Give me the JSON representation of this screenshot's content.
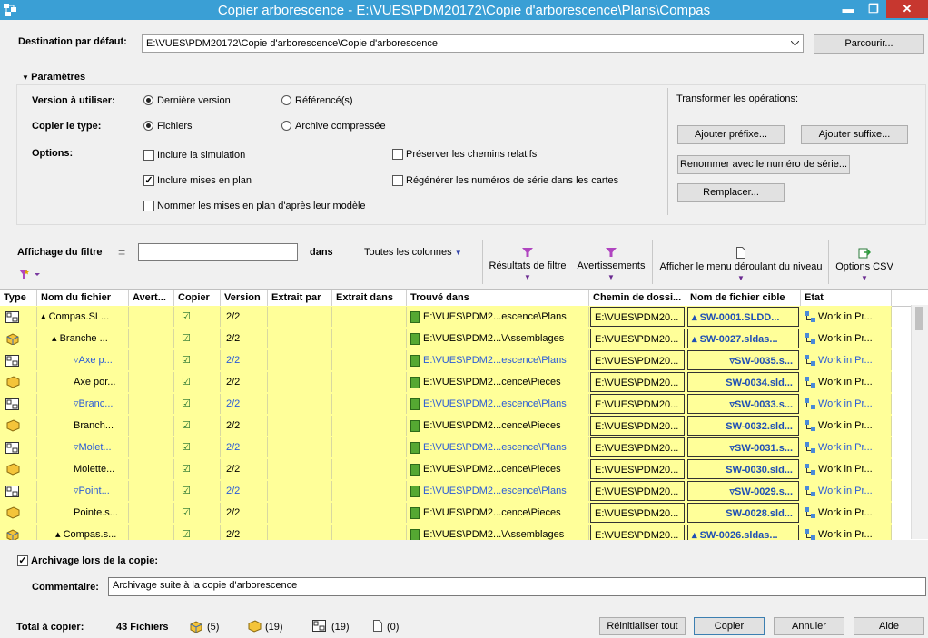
{
  "window": {
    "title": "Copier arborescence - E:\\VUES\\PDM20172\\Copie d'arborescence\\Plans\\Compas",
    "minimize": "▬",
    "maximize": "❐",
    "close": "✕"
  },
  "destination": {
    "label": "Destination par défaut:",
    "value": "E:\\VUES\\PDM20172\\Copie d'arborescence\\Copie d'arborescence",
    "browse": "Parcourir..."
  },
  "parametres": {
    "header": "Paramètres",
    "version_label": "Version à utiliser:",
    "version_latest": "Dernière version",
    "version_ref": "Référencé(s)",
    "type_label": "Copier le type:",
    "type_files": "Fichiers",
    "type_archive": "Archive compressée",
    "options_label": "Options:",
    "opt_simulation": "Inclure la simulation",
    "opt_drawings": "Inclure mises en plan",
    "opt_name_drawings": "Nommer les mises en plan d'après leur modèle",
    "opt_relative": "Préserver les chemins relatifs",
    "opt_serials": "Régénérer les numéros de série dans les cartes",
    "transform_label": "Transformer les opérations:",
    "add_prefix": "Ajouter préfixe...",
    "add_suffix": "Ajouter suffixe...",
    "rename_serial": "Renommer avec le numéro de série...",
    "replace": "Remplacer..."
  },
  "filter": {
    "label": "Affichage du filtre",
    "eq": "=",
    "value": "",
    "in": "dans",
    "columns": "Toutes les colonnes"
  },
  "toolbar": {
    "filter_results": "Résultats de filtre",
    "warnings": "Avertissements",
    "level_menu": "Afficher le menu déroulant du niveau",
    "csv": "Options CSV"
  },
  "grid": {
    "columns": [
      "Type",
      "Nom du fichier",
      "Avert...",
      "Copier",
      "Version",
      "Extrait par",
      "Extrait dans",
      "Trouvé dans",
      "Chemin de dossi...",
      "Nom de fichier cible",
      "Etat"
    ],
    "rows": [
      {
        "type": "drawing",
        "name": "▴ Compas.SL...",
        "copy": "☑",
        "version": "2/2",
        "found": "E:\\VUES\\PDM2...escence\\Plans",
        "path": "E:\\VUES\\PDM20...",
        "target": "▴ SW-0001.SLDD...",
        "state": "Work in Pr...",
        "ref": false,
        "indent": 44
      },
      {
        "type": "assembly",
        "name": "▴ Branche ...",
        "copy": "☑",
        "version": "2/2",
        "found": "E:\\VUES\\PDM2...\\Assemblages",
        "path": "E:\\VUES\\PDM20...",
        "target": "▴ SW-0027.sldas...",
        "state": "Work in Pr...",
        "ref": false,
        "indent": 56
      },
      {
        "type": "drawing",
        "name": "▿Axe p...",
        "copy": "☑",
        "version": "2/2",
        "found": "E:\\VUES\\PDM2...escence\\Plans",
        "path": "E:\\VUES\\PDM20...",
        "target": "▿SW-0035.s...",
        "state": "Work in Pr...",
        "ref": true,
        "indent": 80
      },
      {
        "type": "part",
        "name": "Axe por...",
        "copy": "☑",
        "version": "2/2",
        "found": "E:\\VUES\\PDM2...cence\\Pieces",
        "path": "E:\\VUES\\PDM20...",
        "target": "SW-0034.sld...",
        "state": "Work in Pr...",
        "ref": false,
        "indent": 80
      },
      {
        "type": "drawing",
        "name": "▿Branc...",
        "copy": "☑",
        "version": "2/2",
        "found": "E:\\VUES\\PDM2...escence\\Plans",
        "path": "E:\\VUES\\PDM20...",
        "target": "▿SW-0033.s...",
        "state": "Work in Pr...",
        "ref": true,
        "indent": 80
      },
      {
        "type": "part",
        "name": "Branch...",
        "copy": "☑",
        "version": "2/2",
        "found": "E:\\VUES\\PDM2...cence\\Pieces",
        "path": "E:\\VUES\\PDM20...",
        "target": "SW-0032.sld...",
        "state": "Work in Pr...",
        "ref": false,
        "indent": 80
      },
      {
        "type": "drawing",
        "name": "▿Molet...",
        "copy": "☑",
        "version": "2/2",
        "found": "E:\\VUES\\PDM2...escence\\Plans",
        "path": "E:\\VUES\\PDM20...",
        "target": "▿SW-0031.s...",
        "state": "Work in Pr...",
        "ref": true,
        "indent": 80
      },
      {
        "type": "part",
        "name": "Molette...",
        "copy": "☑",
        "version": "2/2",
        "found": "E:\\VUES\\PDM2...cence\\Pieces",
        "path": "E:\\VUES\\PDM20...",
        "target": "SW-0030.sld...",
        "state": "Work in Pr...",
        "ref": false,
        "indent": 80
      },
      {
        "type": "drawing",
        "name": "▿Point...",
        "copy": "☑",
        "version": "2/2",
        "found": "E:\\VUES\\PDM2...escence\\Plans",
        "path": "E:\\VUES\\PDM20...",
        "target": "▿SW-0029.s...",
        "state": "Work in Pr...",
        "ref": true,
        "indent": 80
      },
      {
        "type": "part",
        "name": "Pointe.s...",
        "copy": "☑",
        "version": "2/2",
        "found": "E:\\VUES\\PDM2...cence\\Pieces",
        "path": "E:\\VUES\\PDM20...",
        "target": "SW-0028.sld...",
        "state": "Work in Pr...",
        "ref": false,
        "indent": 80
      },
      {
        "type": "assembly",
        "name": "▴ Compas.s...",
        "copy": "☑",
        "version": "2/2",
        "found": "E:\\VUES\\PDM2...\\Assemblages",
        "path": "E:\\VUES\\PDM20...",
        "target": "▴ SW-0026.sldas...",
        "state": "Work in Pr...",
        "ref": false,
        "indent": 60
      }
    ]
  },
  "checkin": {
    "label": "Archivage lors de la copie:",
    "comment_label": "Commentaire:",
    "comment": "Archivage suite à la copie d'arborescence"
  },
  "totals": {
    "label": "Total à copier:",
    "files": "43 Fichiers",
    "assemblies": "(5)",
    "parts": "(19)",
    "drawings": "(19)",
    "other": "(0)"
  },
  "actions": {
    "reset": "Réinitialiser tout",
    "copy": "Copier",
    "cancel": "Annuler",
    "help": "Aide"
  },
  "colors": {
    "titlebar": "#3a9fd5",
    "row_highlight": "#ffff99",
    "ref_text": "#2a5bd7"
  }
}
